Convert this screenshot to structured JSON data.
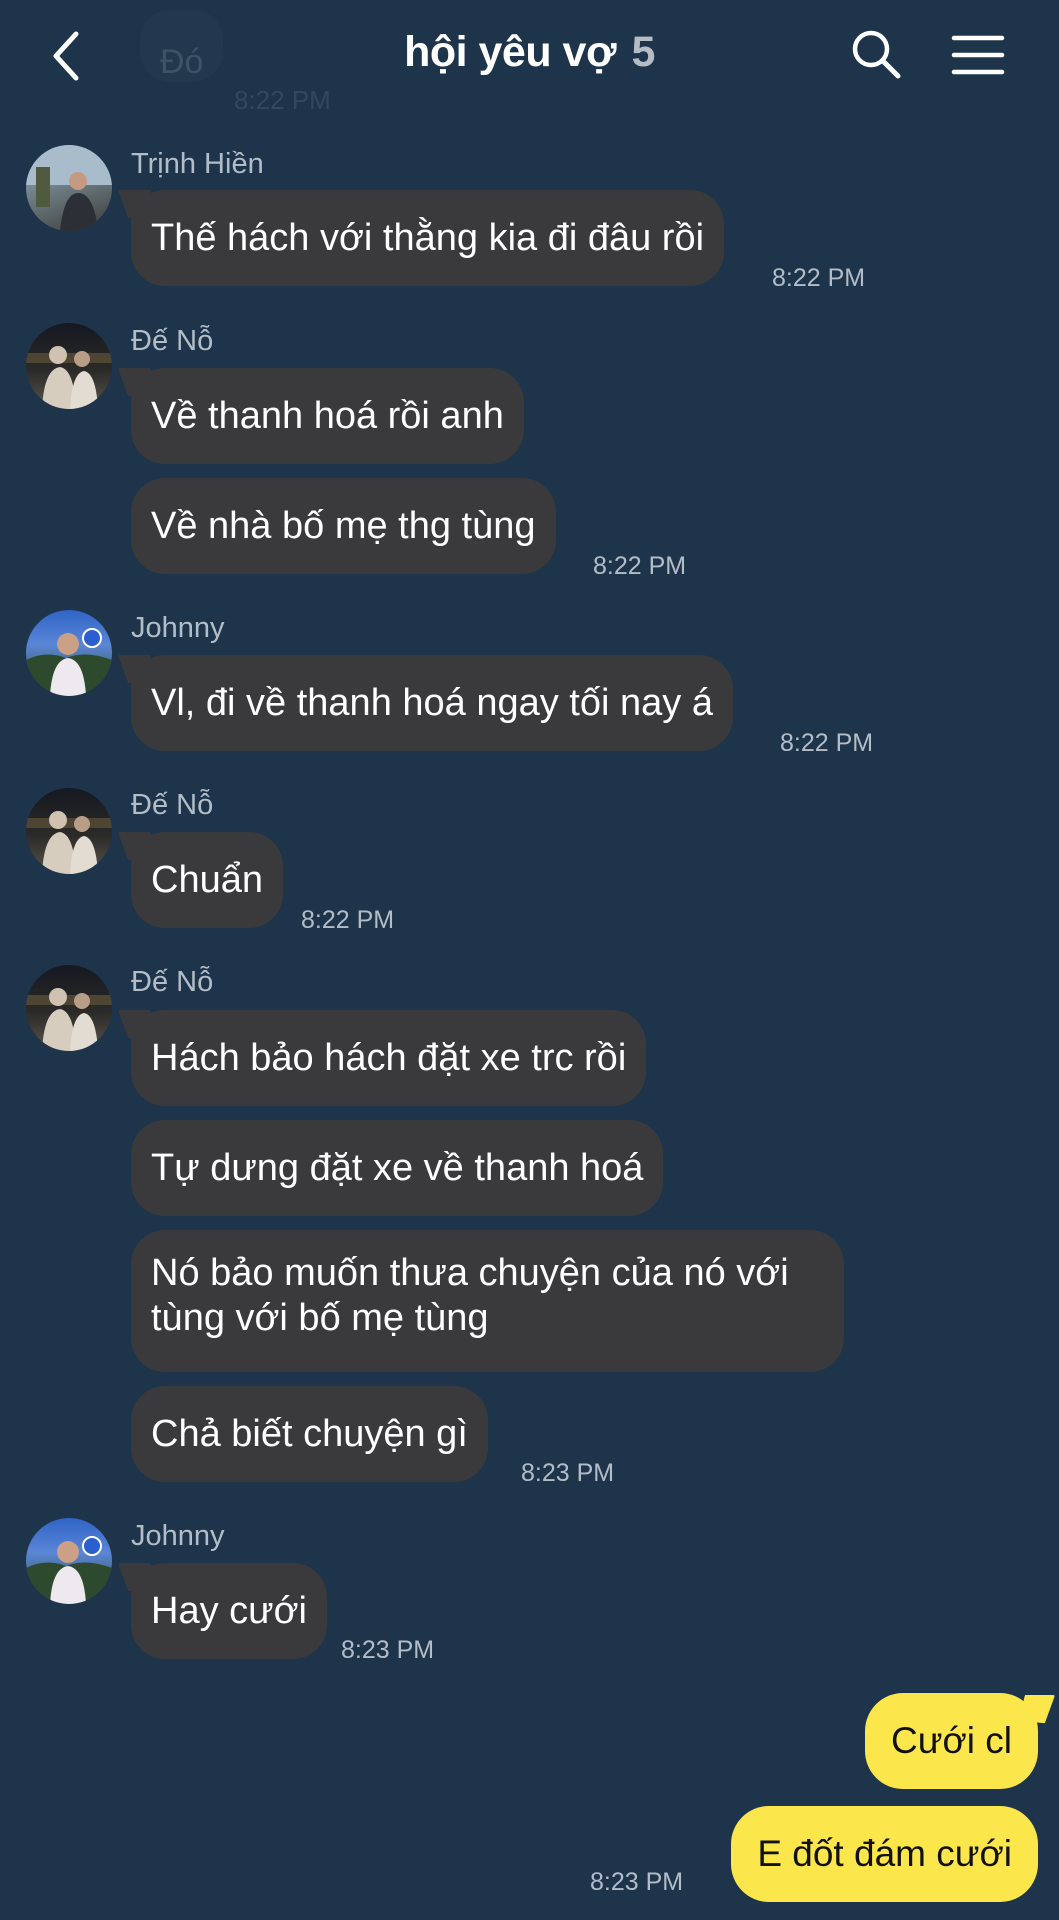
{
  "header": {
    "title": "hội yêu vợ",
    "member_count": "5",
    "ghost_message": "Đó",
    "ghost_time": "8:22 PM"
  },
  "colors": {
    "background": "#1e344a",
    "incoming_bubble": "#3a3a3c",
    "outgoing_bubble": "#fbe64c",
    "meta_text": "#b3bdc8"
  },
  "messages": [
    {
      "sender": "Trịnh Hiền",
      "texts": [
        "Thế hách với thằng kia đi đâu rồi"
      ],
      "time": "8:22 PM"
    },
    {
      "sender": "Đế Nỗ",
      "texts": [
        "Về thanh hoá rồi anh",
        "Về nhà bố mẹ thg tùng"
      ],
      "time": "8:22 PM"
    },
    {
      "sender": "Johnny",
      "texts": [
        "Vl, đi về thanh hoá ngay tối nay á"
      ],
      "time": "8:22 PM"
    },
    {
      "sender": "Đế Nỗ",
      "texts": [
        "Chuẩn"
      ],
      "time": "8:22 PM"
    },
    {
      "sender": "Đế Nỗ",
      "texts": [
        "Hách bảo hách đặt xe trc rồi",
        "Tự dưng đặt xe về thanh hoá",
        "Nó bảo muốn thưa chuyện của nó với tùng với bố mẹ tùng",
        "Chả biết chuyện gì"
      ],
      "time": "8:23 PM"
    },
    {
      "sender": "Johnny",
      "texts": [
        "Hay cưới"
      ],
      "time": "8:23 PM"
    }
  ],
  "outgoing": {
    "texts": [
      "Cưới cl",
      "E đốt đám cưới"
    ],
    "time": "8:23 PM"
  }
}
